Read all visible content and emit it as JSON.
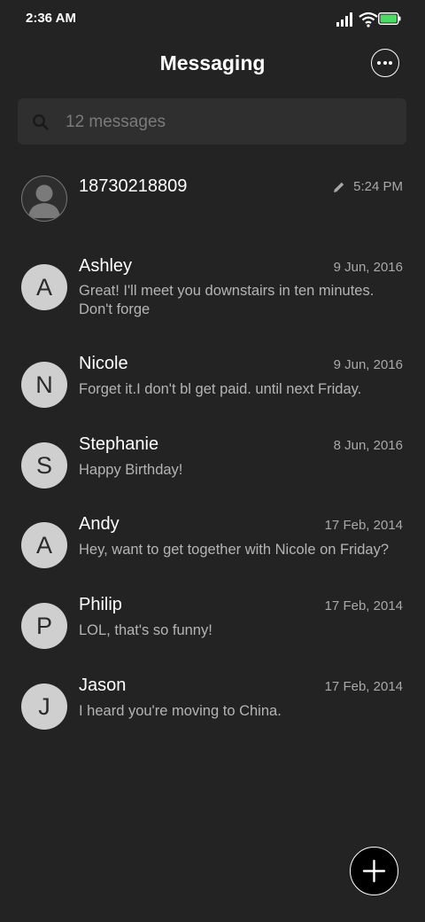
{
  "status": {
    "time": "2:36 AM"
  },
  "header": {
    "title": "Messaging",
    "more_icon": "more-dots-icon"
  },
  "search": {
    "placeholder": "12 messages",
    "icon": "search-icon"
  },
  "conversations": [
    {
      "name": "18730218809",
      "time": "5:24 PM",
      "snippet": "",
      "avatar": "person-silhouette",
      "draft": true
    },
    {
      "name": "Ashley",
      "initial": "A",
      "date": "9 Jun, 2016",
      "snippet": "Great! I'll meet you downstairs in ten minutes. Don't forge"
    },
    {
      "name": "Nicole",
      "initial": "N",
      "date": "9 Jun, 2016",
      "snippet": "Forget it.I don't bl get paid. until next Friday."
    },
    {
      "name": "Stephanie",
      "initial": "S",
      "date": "8 Jun, 2016",
      "snippet": "Happy Birthday!"
    },
    {
      "name": "Andy",
      "initial": "A",
      "date": "17 Feb, 2014",
      "snippet": "Hey, want to get together with Nicole on Friday?"
    },
    {
      "name": "Philip",
      "initial": "P",
      "date": "17 Feb, 2014",
      "snippet": "LOL, that's so funny!"
    },
    {
      "name": "Jason",
      "initial": "J",
      "date": "17 Feb, 2014",
      "snippet": "I heard you're moving to China."
    }
  ],
  "fab": {
    "icon": "plus-icon"
  },
  "colors": {
    "background": "#232323",
    "avatar_bg": "#cfcfcf",
    "battery": "#4cd964"
  }
}
